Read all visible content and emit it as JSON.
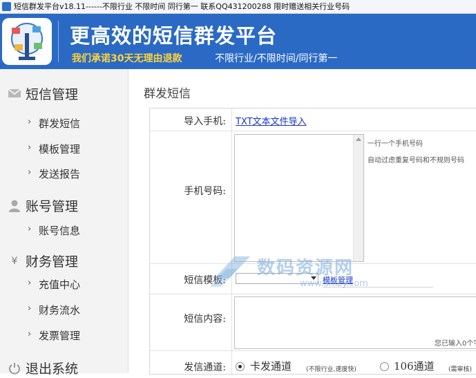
{
  "window": {
    "title": "短信群发平台v18.11------不限行业 不限时间 同行第一    联系QQ431200288 限时赠送相关行业号码"
  },
  "banner": {
    "headline": "更高效的短信群发平台",
    "promo": "我们承诺30天无理由退款",
    "subpromo": "不限行业/不限时间/同行第一"
  },
  "sidebar": {
    "sections": [
      {
        "label": "短信管理",
        "icon": "mail-icon",
        "items": [
          "群发短信",
          "模板管理",
          "发送报告"
        ]
      },
      {
        "label": "账号管理",
        "icon": "user-icon",
        "items": [
          "账号信息"
        ]
      },
      {
        "label": "财务管理",
        "icon": "yen-icon",
        "items": [
          "充值中心",
          "财务流水",
          "发票管理"
        ]
      },
      {
        "label": "退出系统",
        "icon": "power-icon",
        "items": []
      }
    ]
  },
  "main": {
    "page_title": "群发短信",
    "form": {
      "import_label": "导入手机:",
      "import_link": "TXT文本文件导入",
      "phones_label": "手机号码:",
      "phones_value": "",
      "hint_line1": "一行一个手机号码",
      "hint_line2": "自动过虑重复号码和不规则号码",
      "template_label": "短信模板:",
      "template_link": "模板管理",
      "content_label": "短信内容:",
      "content_value": "",
      "char_count_text": "您已输入0个字",
      "channel_label": "发信通道:",
      "channels": [
        {
          "label": "卡发通道",
          "note": "(不限行业,速度快)",
          "selected": true
        },
        {
          "label": "106通道",
          "note": "(需审核)",
          "selected": false
        }
      ]
    }
  },
  "watermark": {
    "text": "数码资源网",
    "url": "www.smzy.com"
  },
  "colors": {
    "banner": "#2a6ac4",
    "promo": "#ffd23a",
    "link": "#1a35c8",
    "sidebar": "#f3f3f3"
  }
}
